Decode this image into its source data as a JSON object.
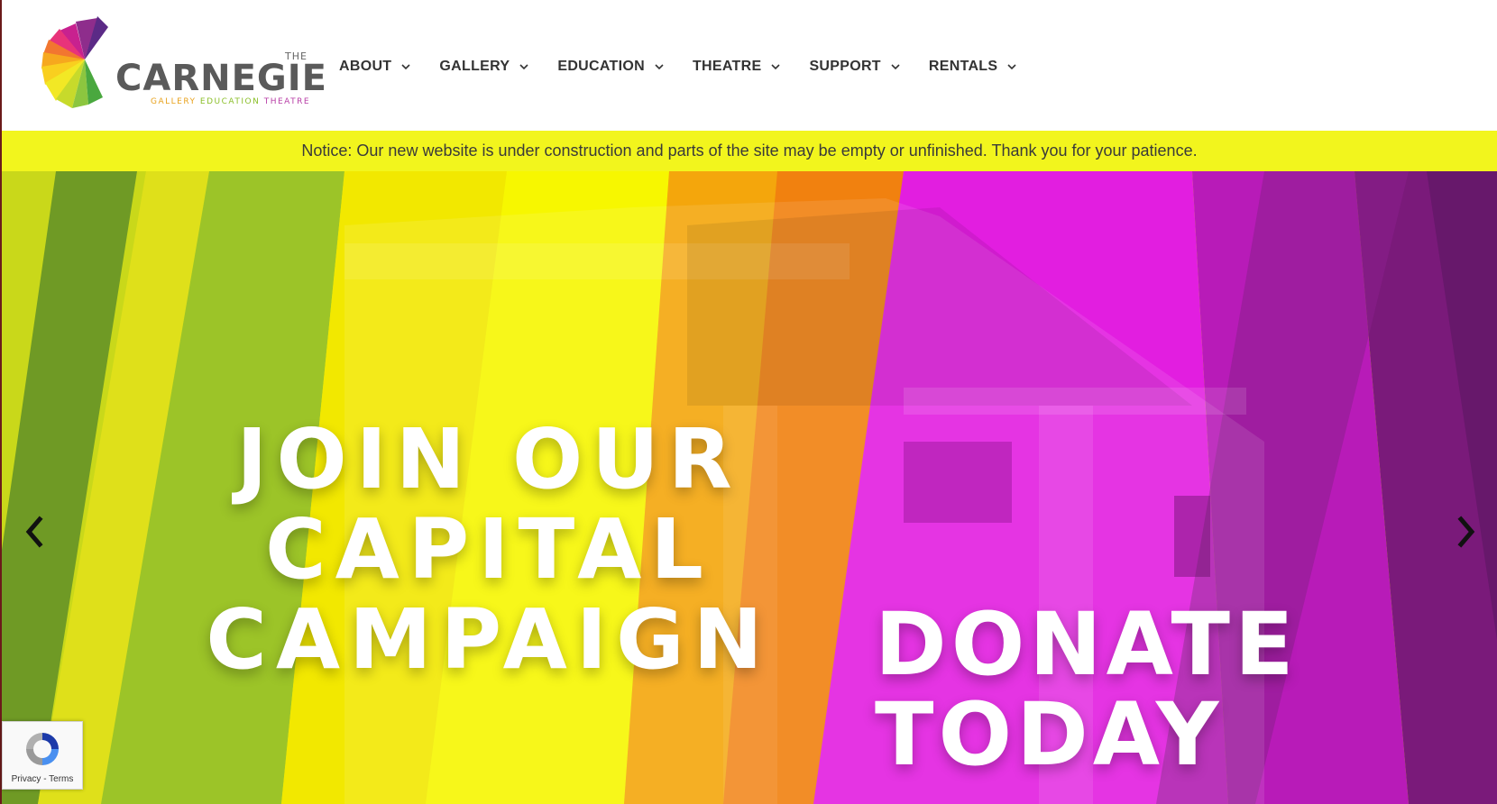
{
  "logo": {
    "the": "THE",
    "name": "CARNEGIE",
    "tagline": [
      {
        "text": "GALLERY",
        "color": "#e8a21d"
      },
      {
        "text": "EDUCATION",
        "color": "#8bbf2a"
      },
      {
        "text": "THEATRE",
        "color": "#b83ea6"
      }
    ]
  },
  "nav": {
    "items": [
      {
        "label": "ABOUT"
      },
      {
        "label": "GALLERY"
      },
      {
        "label": "EDUCATION"
      },
      {
        "label": "THEATRE"
      },
      {
        "label": "SUPPORT"
      },
      {
        "label": "RENTALS"
      }
    ],
    "chevron_icon": "chevron-down-icon"
  },
  "notice": {
    "text": "Notice: Our new website is under construction and parts of the site may be empty or unfinished. Thank you for your patience.",
    "background": "#f2f51d"
  },
  "hero": {
    "campaign_lines": [
      "JOIN OUR",
      "CAPITAL",
      "CAMPAIGN"
    ],
    "donate_lines": [
      "DONATE",
      "TODAY"
    ],
    "prev_icon": "chevron-left-icon",
    "next_icon": "chevron-right-icon"
  },
  "recaptcha": {
    "privacy": "Privacy",
    "separator": " - ",
    "terms": "Terms"
  },
  "colors": {
    "nav_text": "#333333",
    "logo_text": "#5a5a5a",
    "hero_yellow": "#f4f000",
    "hero_magenta": "#e21ee0",
    "hero_purple": "#7a1a7a"
  }
}
